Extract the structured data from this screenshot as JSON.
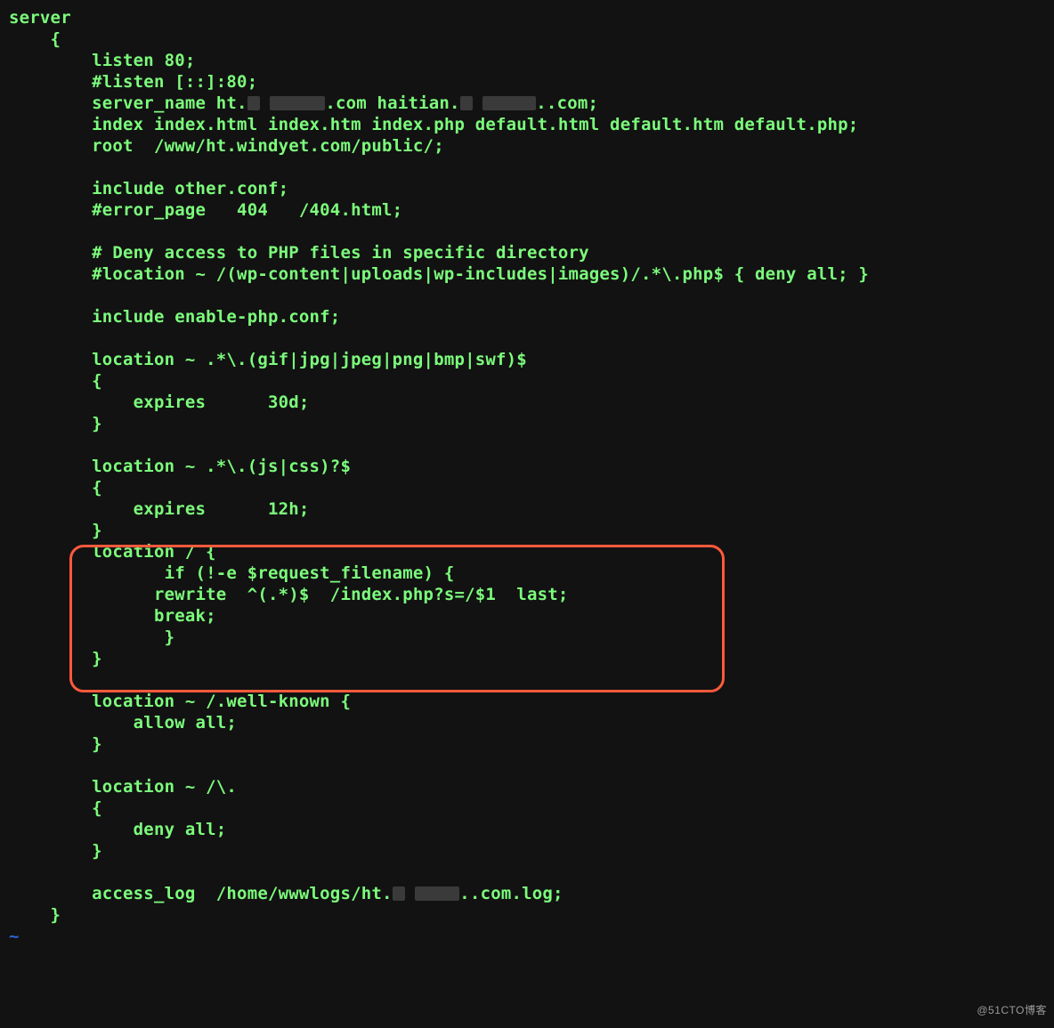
{
  "colors": {
    "bg": "#121212",
    "fg": "#7cfc7c",
    "highlight_border": "#ff5a3c",
    "tilde": "#2b66d6",
    "watermark": "#9a9a9a",
    "redact_fill": "#3a3a3a"
  },
  "watermark": "@51CTO博客",
  "tilde_char": "~",
  "code": {
    "lines": [
      "server",
      "    {",
      "        listen 80;",
      "        #listen [::]:80;",
      "        server_name ht.{R1} {R2}.com haitian.{R3} {R4}..com;",
      "        index index.html index.htm index.php default.html default.htm default.php;",
      "        root  /www/ht.windyet.com/public/;",
      "",
      "        include other.conf;",
      "        #error_page   404   /404.html;",
      "",
      "        # Deny access to PHP files in specific directory",
      "        #location ~ /(wp-content|uploads|wp-includes|images)/.*\\.php$ { deny all; }",
      "",
      "        include enable-php.conf;",
      "",
      "        location ~ .*\\.(gif|jpg|jpeg|png|bmp|swf)$",
      "        {",
      "            expires      30d;",
      "        }",
      "",
      "        location ~ .*\\.(js|css)?$",
      "        {",
      "            expires      12h;",
      "        }",
      "        location / {",
      "               if (!-e $request_filename) {",
      "              rewrite  ^(.*)$  /index.php?s=/$1  last;",
      "              break;",
      "               }",
      "        }",
      "",
      "        location ~ /.well-known {",
      "            allow all;",
      "        }",
      "",
      "        location ~ /\\.",
      "        {",
      "            deny all;",
      "        }",
      "",
      "        access_log  /home/wwwlogs/ht.{R5} {R6}..com.log;",
      "    }"
    ],
    "highlight_range": [
      25,
      30
    ]
  }
}
